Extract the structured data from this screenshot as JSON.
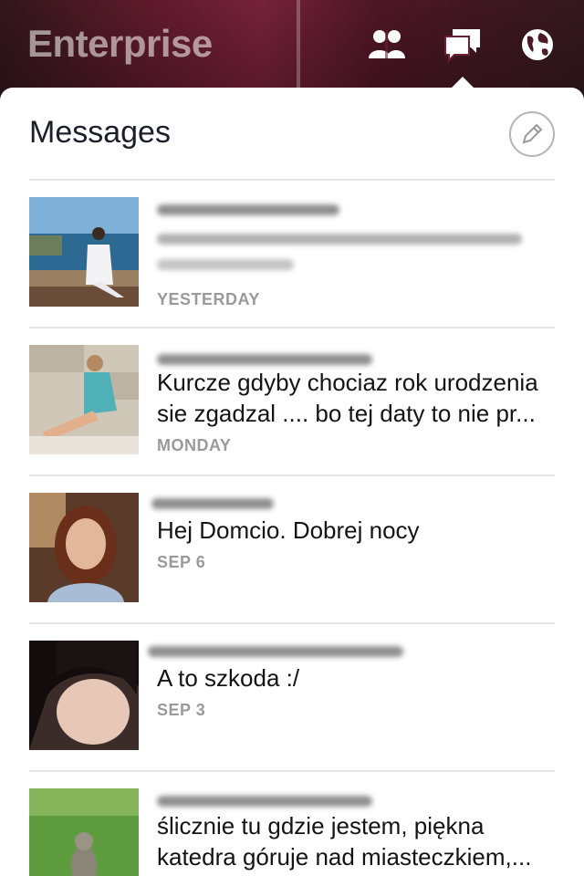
{
  "app": {
    "title": "Enterprise"
  },
  "nav": {
    "icons": [
      "friends-icon",
      "messages-icon",
      "globe-icon"
    ],
    "active": "messages-icon"
  },
  "panel": {
    "title": "Messages"
  },
  "messages": [
    {
      "name": "",
      "preview": "",
      "time": "YESTERDAY"
    },
    {
      "name": "",
      "preview_line1": "Kurcze gdyby chociaz rok urodzenia",
      "preview_line2": "sie zgadzal .... bo tej daty to nie pr...",
      "time": "MONDAY"
    },
    {
      "name": "",
      "preview_line1": "Hej Domcio.  Dobrej nocy",
      "time": "SEP 6"
    },
    {
      "name": "",
      "preview_line1": "A to szkoda :/",
      "time": "SEP 3"
    },
    {
      "name": "",
      "preview_line1": "ślicznie tu gdzie jestem, piękna",
      "preview_line2": "katedra góruje nad miasteczkiem,..."
    }
  ],
  "colors": {
    "accent_bg": "#6e1f33",
    "text": "#141414",
    "muted": "#9a9a9a",
    "divider": "#e3e3e3"
  }
}
